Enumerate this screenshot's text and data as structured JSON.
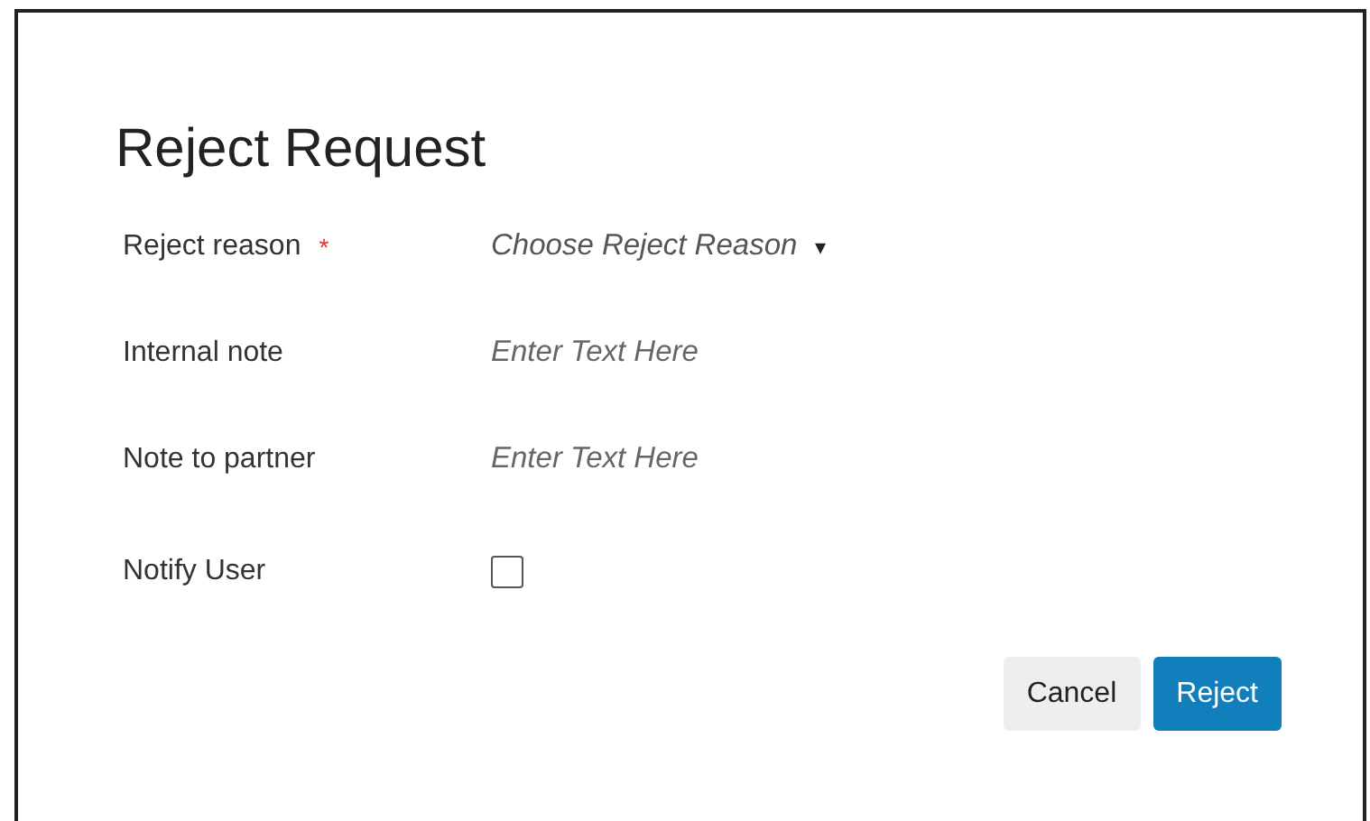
{
  "dialog": {
    "title": "Reject Request",
    "fields": [
      {
        "label": "Reject reason",
        "required_mark": "*",
        "kind": "dropdown",
        "placeholder": "Choose Reject Reason",
        "caret": "▾"
      },
      {
        "label": "Internal note",
        "kind": "text",
        "placeholder": "Enter Text Here"
      },
      {
        "label": "Note to partner",
        "kind": "text",
        "placeholder": "Enter Text Here"
      },
      {
        "label": "Notify User",
        "kind": "checkbox",
        "checked": false
      }
    ],
    "buttons": [
      {
        "label": "Cancel",
        "kind": "secondary"
      },
      {
        "label": "Reject",
        "kind": "primary"
      }
    ]
  }
}
